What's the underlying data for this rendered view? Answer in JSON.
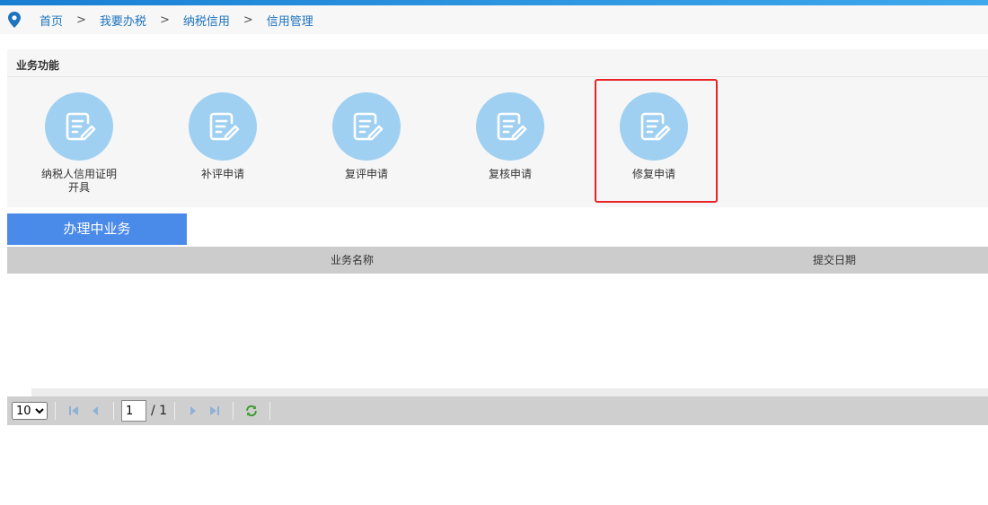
{
  "breadcrumb": [
    {
      "label": "首页"
    },
    {
      "label": "我要办税"
    },
    {
      "label": "纳税信用"
    },
    {
      "label": "信用管理"
    }
  ],
  "breadcrumb_separator": ">",
  "panel": {
    "title": "业务功能",
    "functions": [
      {
        "label": "纳税人信用证明开具",
        "icon": "document-edit-icon"
      },
      {
        "label": "补评申请",
        "icon": "document-edit-icon"
      },
      {
        "label": "复评申请",
        "icon": "document-edit-icon"
      },
      {
        "label": "复核申请",
        "icon": "document-edit-icon"
      },
      {
        "label": "修复申请",
        "icon": "document-edit-icon",
        "highlighted": true
      }
    ]
  },
  "tab": {
    "label": "办理中业务"
  },
  "table": {
    "columns": [
      "业务名称",
      "提交日期"
    ],
    "rows": []
  },
  "pager": {
    "page_size": "10",
    "page_size_options": [
      "10"
    ],
    "current_page": "1",
    "total_pages_text": "/ 1"
  },
  "colors": {
    "accent": "#4a8ae8",
    "icon_circle": "#9fd0f2",
    "highlight_border": "#e8242a",
    "link": "#1e73be"
  }
}
